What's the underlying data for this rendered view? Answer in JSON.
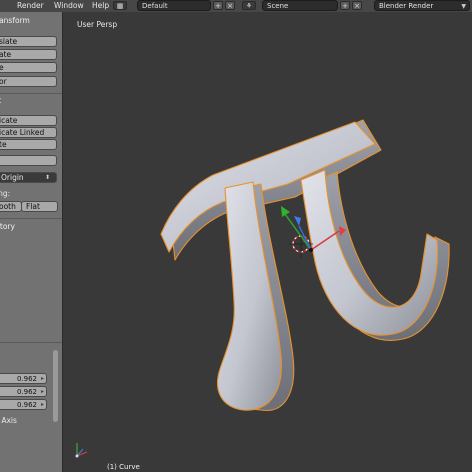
{
  "menu": {
    "render": "Render",
    "window": "Window",
    "help": "Help"
  },
  "header": {
    "layout": "Default",
    "scene": "Scene",
    "engine": "Blender Render"
  },
  "toolshelf": {
    "transform_title": "ransform",
    "transform_buttons": [
      "slate",
      "ate",
      "e",
      "or"
    ],
    "edit_title": "it",
    "edit_buttons": [
      "icate",
      "icate Linked",
      "te",
      ""
    ],
    "origin_button": "Origin",
    "shading_label": "ing:",
    "smooth_label": "ooth",
    "flat_label": "Flat",
    "history_title": "story",
    "scale_values": [
      "0.962",
      "0.962",
      "0.962"
    ],
    "axis_label": "t Axis"
  },
  "viewport": {
    "view_label": "User Persp",
    "object_label": "(1) Curve"
  },
  "colors": {
    "menu_bg": "#474747",
    "shelf_bg": "#727272",
    "viewport_bg": "#393939",
    "select_outline": "#e8912a"
  }
}
